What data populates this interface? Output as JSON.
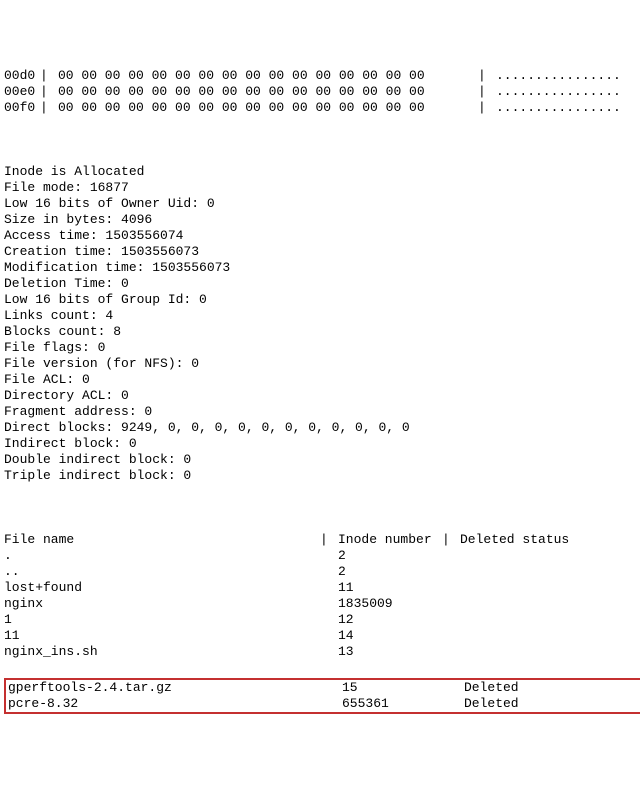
{
  "hex": {
    "rows": [
      {
        "offset": "00d0",
        "bytes": "00 00 00 00 00 00 00 00 00 00 00 00 00 00 00 00",
        "ascii": "................"
      },
      {
        "offset": "00e0",
        "bytes": "00 00 00 00 00 00 00 00 00 00 00 00 00 00 00 00",
        "ascii": "................"
      },
      {
        "offset": "00f0",
        "bytes": "00 00 00 00 00 00 00 00 00 00 00 00 00 00 00 00",
        "ascii": "................"
      }
    ],
    "sep": "|"
  },
  "info": [
    "Inode is Allocated",
    "File mode: 16877",
    "Low 16 bits of Owner Uid: 0",
    "Size in bytes: 4096",
    "Access time: 1503556074",
    "Creation time: 1503556073",
    "Modification time: 1503556073",
    "Deletion Time: 0",
    "Low 16 bits of Group Id: 0",
    "Links count: 4",
    "Blocks count: 8",
    "File flags: 0",
    "File version (for NFS): 0",
    "File ACL: 0",
    "Directory ACL: 0",
    "Fragment address: 0",
    "Direct blocks: 9249, 0, 0, 0, 0, 0, 0, 0, 0, 0, 0, 0",
    "Indirect block: 0",
    "Double indirect block: 0",
    "Triple indirect block: 0"
  ],
  "table": {
    "header": {
      "name": "File name",
      "inode": "Inode number",
      "status": "Deleted status"
    },
    "sep": "|",
    "rows": [
      {
        "name": ".",
        "inode": "2",
        "status": ""
      },
      {
        "name": "..",
        "inode": "2",
        "status": ""
      },
      {
        "name": "lost+found",
        "inode": "11",
        "status": ""
      },
      {
        "name": "nginx",
        "inode": "1835009",
        "status": ""
      },
      {
        "name": "1",
        "inode": "12",
        "status": ""
      },
      {
        "name": "11",
        "inode": "14",
        "status": ""
      },
      {
        "name": "nginx_ins.sh",
        "inode": "13",
        "status": ""
      }
    ],
    "highlight": [
      {
        "name": "gperftools-2.4.tar.gz",
        "inode": "15",
        "status": "Deleted"
      },
      {
        "name": "pcre-8.32",
        "inode": "655361",
        "status": "Deleted"
      }
    ]
  }
}
